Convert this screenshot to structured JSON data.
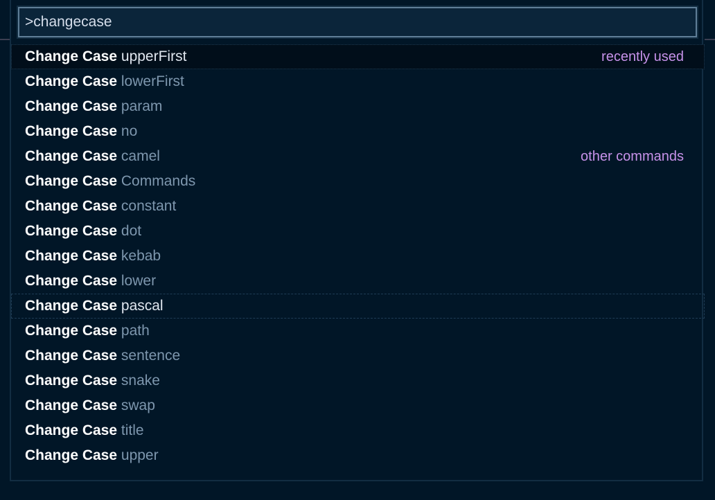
{
  "palette": {
    "input": {
      "value": ">changecase",
      "placeholder": ""
    },
    "prefix": "Change Case",
    "items": [
      {
        "name": "upperFirst",
        "group_label": "recently used",
        "state": "active"
      },
      {
        "name": "lowerFirst",
        "group_label": "",
        "state": ""
      },
      {
        "name": "param",
        "group_label": "",
        "state": ""
      },
      {
        "name": "no",
        "group_label": "",
        "state": ""
      },
      {
        "name": "camel",
        "group_label": "other commands",
        "state": ""
      },
      {
        "name": "Commands",
        "group_label": "",
        "state": ""
      },
      {
        "name": "constant",
        "group_label": "",
        "state": ""
      },
      {
        "name": "dot",
        "group_label": "",
        "state": ""
      },
      {
        "name": "kebab",
        "group_label": "",
        "state": ""
      },
      {
        "name": "lower",
        "group_label": "",
        "state": ""
      },
      {
        "name": "pascal",
        "group_label": "",
        "state": "hover"
      },
      {
        "name": "path",
        "group_label": "",
        "state": ""
      },
      {
        "name": "sentence",
        "group_label": "",
        "state": ""
      },
      {
        "name": "snake",
        "group_label": "",
        "state": ""
      },
      {
        "name": "swap",
        "group_label": "",
        "state": ""
      },
      {
        "name": "title",
        "group_label": "",
        "state": ""
      },
      {
        "name": "upper",
        "group_label": "",
        "state": ""
      }
    ]
  },
  "colors": {
    "background": "#011627",
    "group_label": "#c792ea",
    "prefix_text": "#ffffff",
    "name_text": "#7e97ae",
    "input_border": "#5f7e97"
  }
}
